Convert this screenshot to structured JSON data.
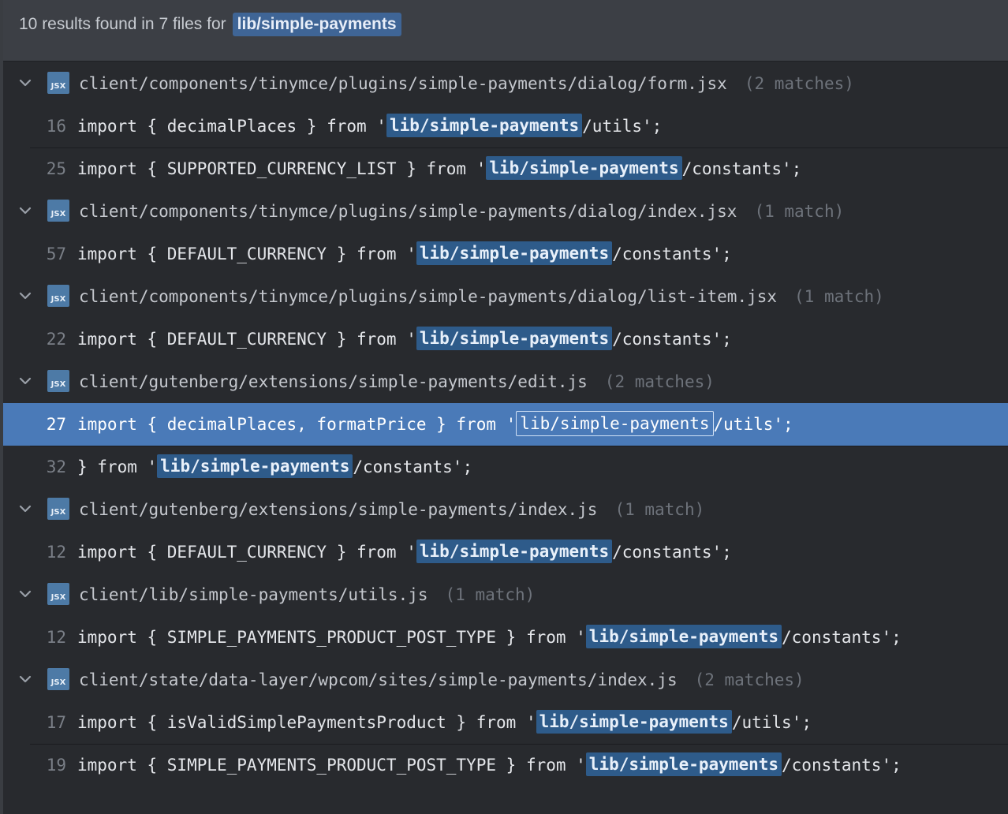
{
  "header": {
    "summary": "10 results found in 7 files for",
    "query": "lib/simple-payments"
  },
  "colors": {
    "highlight": "#2e5b8a",
    "selected_row": "#4a7ab8",
    "file_icon": "#4d7aa6"
  },
  "files": [
    {
      "icon": "JSX",
      "path": "client/components/tinymce/plugins/simple-payments/dialog/form.jsx",
      "count": "(2 matches)",
      "matches": [
        {
          "line": "16",
          "before": "import { decimalPlaces } from '",
          "match": "lib/simple-payments",
          "after": "/utils';",
          "selected": false
        },
        {
          "line": "25",
          "before": "import { SUPPORTED_CURRENCY_LIST } from '",
          "match": "lib/simple-payments",
          "after": "/constants';",
          "selected": false
        }
      ]
    },
    {
      "icon": "JSX",
      "path": "client/components/tinymce/plugins/simple-payments/dialog/index.jsx",
      "count": "(1 match)",
      "matches": [
        {
          "line": "57",
          "before": "import { DEFAULT_CURRENCY } from '",
          "match": "lib/simple-payments",
          "after": "/constants';",
          "selected": false
        }
      ]
    },
    {
      "icon": "JSX",
      "path": "client/components/tinymce/plugins/simple-payments/dialog/list-item.jsx",
      "count": "(1 match)",
      "matches": [
        {
          "line": "22",
          "before": "import { DEFAULT_CURRENCY } from '",
          "match": "lib/simple-payments",
          "after": "/constants';",
          "selected": false
        }
      ]
    },
    {
      "icon": "JSX",
      "path": "client/gutenberg/extensions/simple-payments/edit.js",
      "count": "(2 matches)",
      "matches": [
        {
          "line": "27",
          "before": "import { decimalPlaces, formatPrice } from '",
          "match": "lib/simple-payments",
          "after": "/utils';",
          "selected": true
        },
        {
          "line": "32",
          "before": "} from '",
          "match": "lib/simple-payments",
          "after": "/constants';",
          "selected": false
        }
      ]
    },
    {
      "icon": "JSX",
      "path": "client/gutenberg/extensions/simple-payments/index.js",
      "count": "(1 match)",
      "matches": [
        {
          "line": "12",
          "before": "import { DEFAULT_CURRENCY } from '",
          "match": "lib/simple-payments",
          "after": "/constants';",
          "selected": false
        }
      ]
    },
    {
      "icon": "JSX",
      "path": "client/lib/simple-payments/utils.js",
      "count": "(1 match)",
      "matches": [
        {
          "line": "12",
          "before": "import { SIMPLE_PAYMENTS_PRODUCT_POST_TYPE } from '",
          "match": "lib/simple-payments",
          "after": "/constants';",
          "selected": false
        }
      ]
    },
    {
      "icon": "JSX",
      "path": "client/state/data-layer/wpcom/sites/simple-payments/index.js",
      "count": "(2 matches)",
      "matches": [
        {
          "line": "17",
          "before": "import { isValidSimplePaymentsProduct } from '",
          "match": "lib/simple-payments",
          "after": "/utils';",
          "selected": false
        },
        {
          "line": "19",
          "before": "import { SIMPLE_PAYMENTS_PRODUCT_POST_TYPE } from '",
          "match": "lib/simple-payments",
          "after": "/constants';",
          "selected": false
        }
      ]
    }
  ]
}
